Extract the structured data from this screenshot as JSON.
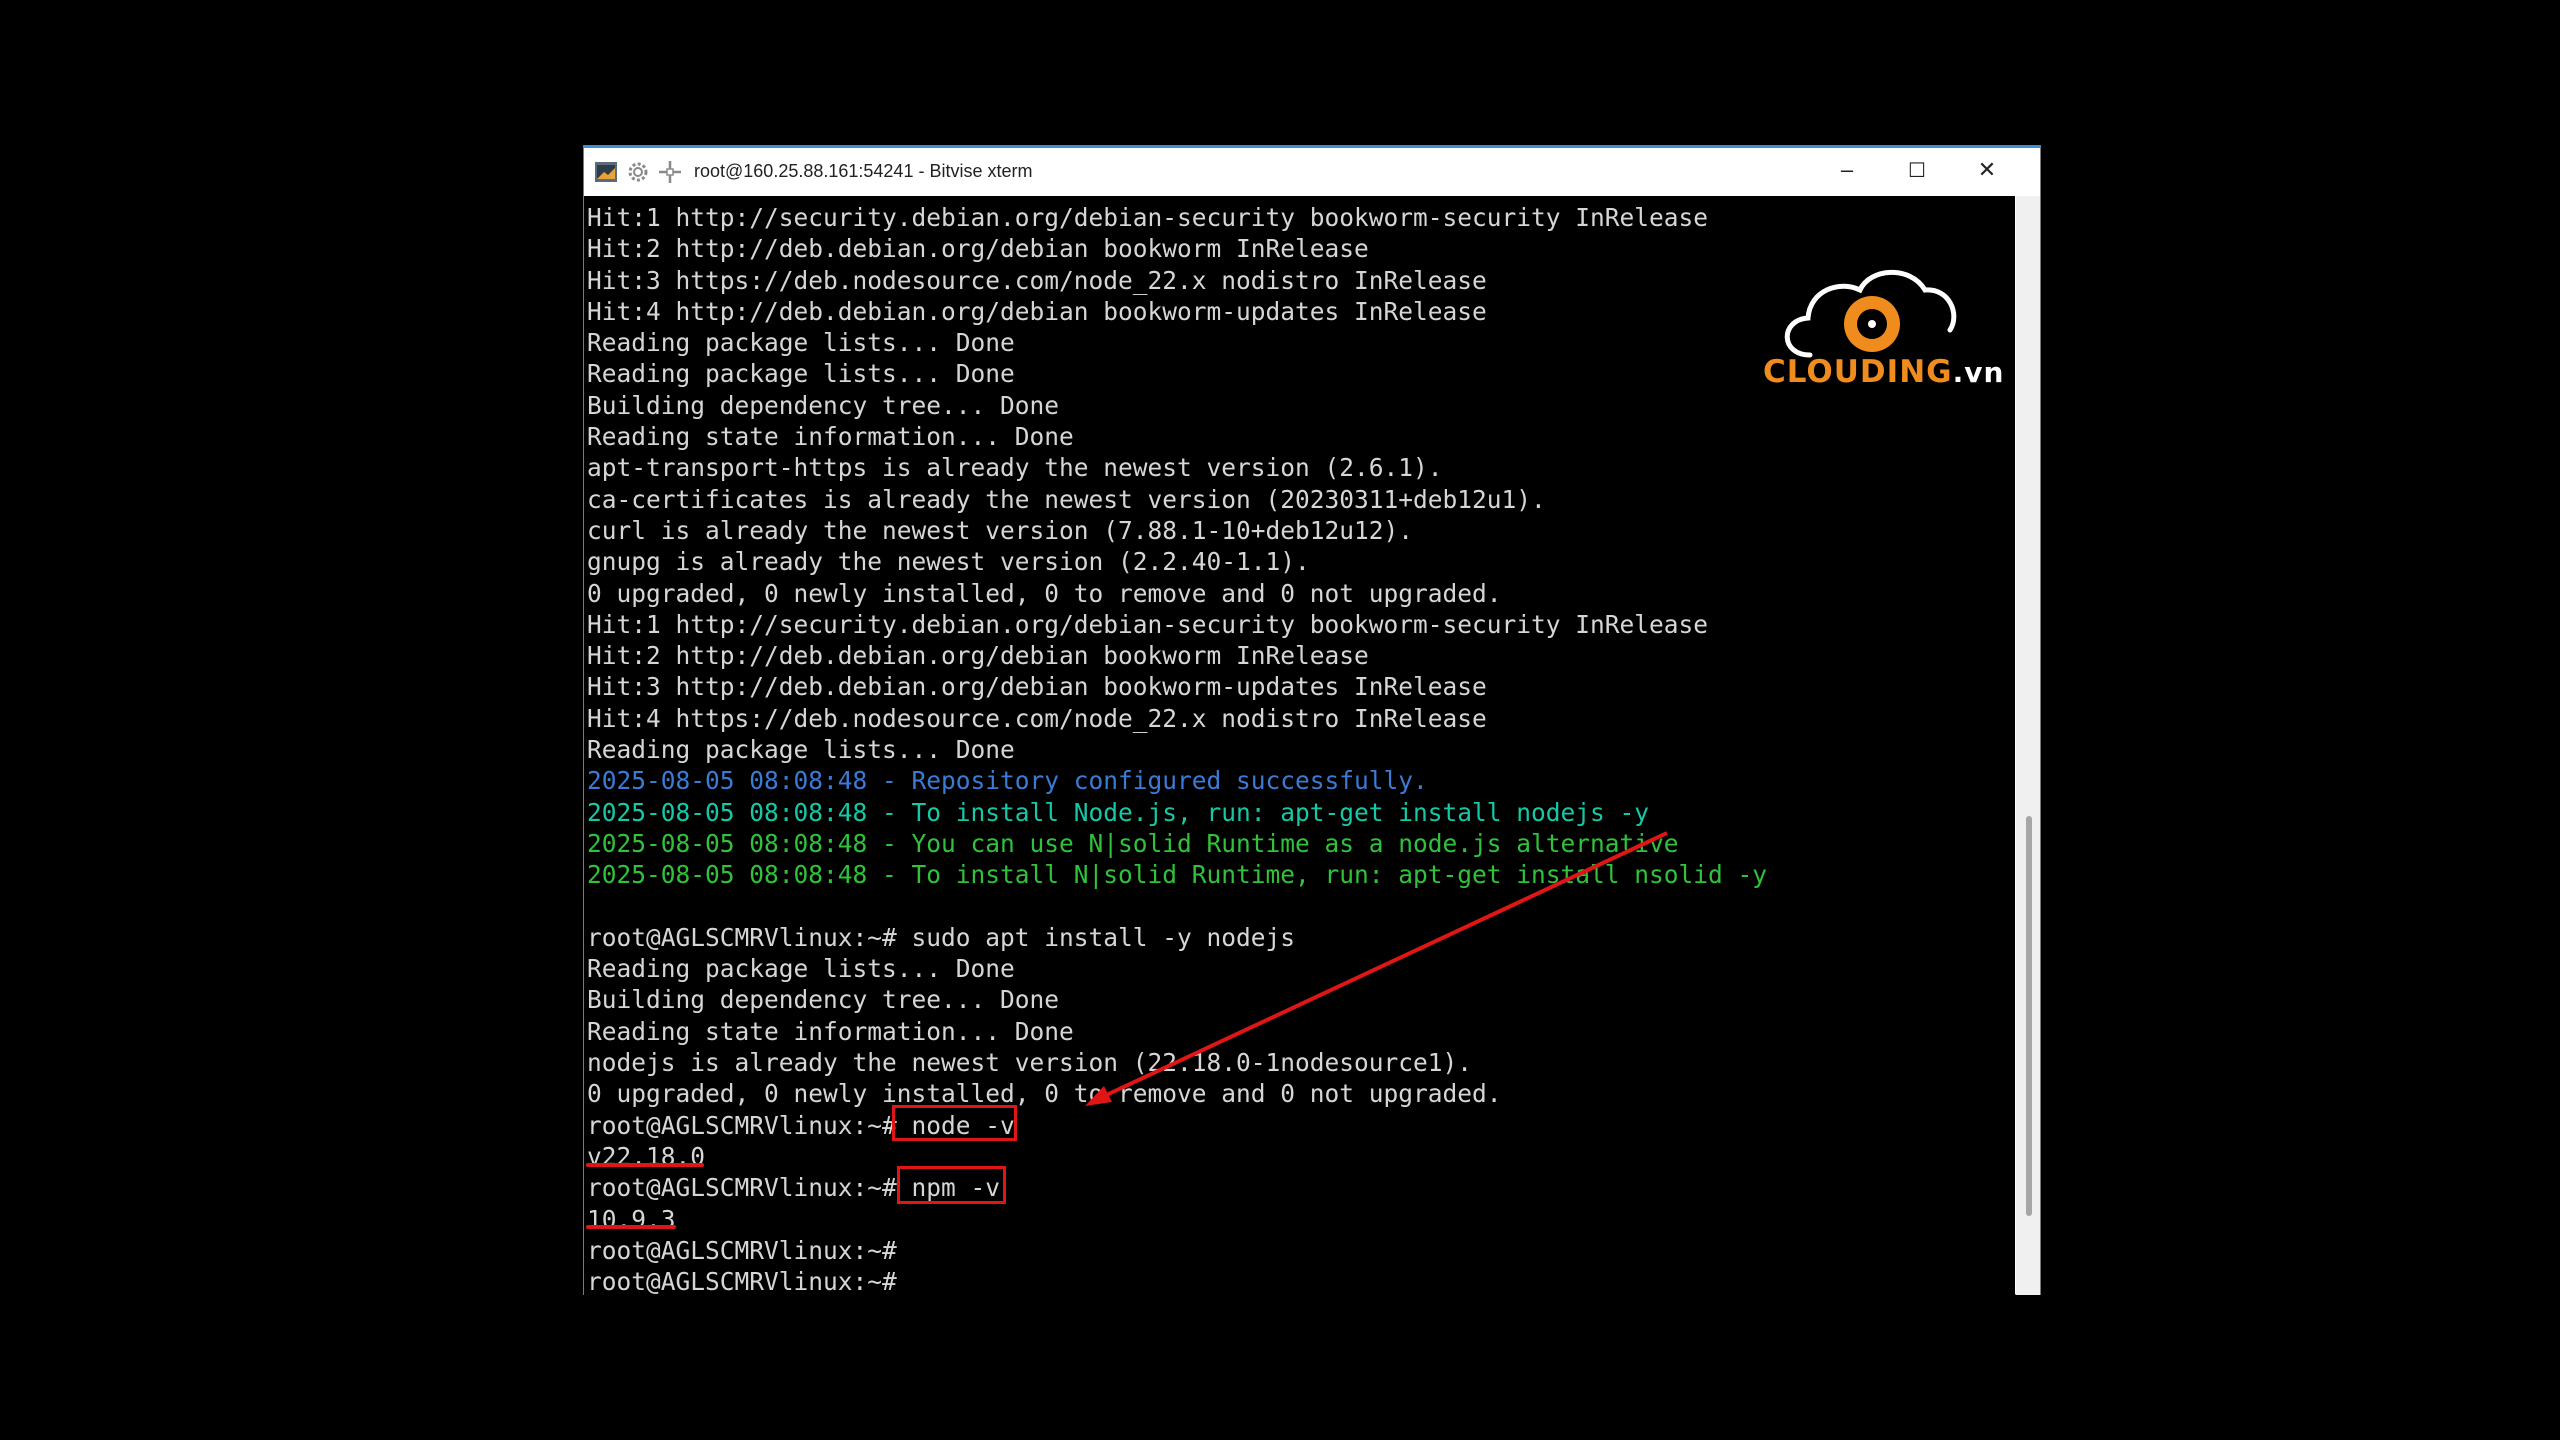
{
  "window": {
    "title": "root@160.25.88.161:54241 - Bitvise xterm",
    "accent_color": "#3b8fd6",
    "icons": [
      "terminal-app-icon",
      "gear-icon",
      "move-icon"
    ],
    "controls": {
      "minimize": "–",
      "maximize": "☐",
      "close": "✕"
    }
  },
  "logo": {
    "brand": "CLOUDING",
    "tld": ".vn",
    "brand_color": "#f08c1e"
  },
  "terminal": {
    "background": "#000000",
    "lines": [
      {
        "text": "Hit:1 http://security.debian.org/debian-security bookworm-security InRelease",
        "color": "default"
      },
      {
        "text": "Hit:2 http://deb.debian.org/debian bookworm InRelease",
        "color": "default"
      },
      {
        "text": "Hit:3 https://deb.nodesource.com/node_22.x nodistro InRelease",
        "color": "default"
      },
      {
        "text": "Hit:4 http://deb.debian.org/debian bookworm-updates InRelease",
        "color": "default"
      },
      {
        "text": "Reading package lists... Done",
        "color": "default"
      },
      {
        "text": "Reading package lists... Done",
        "color": "default"
      },
      {
        "text": "Building dependency tree... Done",
        "color": "default"
      },
      {
        "text": "Reading state information... Done",
        "color": "default"
      },
      {
        "text": "apt-transport-https is already the newest version (2.6.1).",
        "color": "default"
      },
      {
        "text": "ca-certificates is already the newest version (20230311+deb12u1).",
        "color": "default"
      },
      {
        "text": "curl is already the newest version (7.88.1-10+deb12u12).",
        "color": "default"
      },
      {
        "text": "gnupg is already the newest version (2.2.40-1.1).",
        "color": "default"
      },
      {
        "text": "0 upgraded, 0 newly installed, 0 to remove and 0 not upgraded.",
        "color": "default"
      },
      {
        "text": "Hit:1 http://security.debian.org/debian-security bookworm-security InRelease",
        "color": "default"
      },
      {
        "text": "Hit:2 http://deb.debian.org/debian bookworm InRelease",
        "color": "default"
      },
      {
        "text": "Hit:3 http://deb.debian.org/debian bookworm-updates InRelease",
        "color": "default"
      },
      {
        "text": "Hit:4 https://deb.nodesource.com/node_22.x nodistro InRelease",
        "color": "default"
      },
      {
        "text": "Reading package lists... Done",
        "color": "default"
      },
      {
        "text": "2025-08-05 08:08:48 - Repository configured successfully.",
        "color": "blue"
      },
      {
        "text": "2025-08-05 08:08:48 - To install Node.js, run: apt-get install nodejs -y",
        "color": "teal"
      },
      {
        "text": "2025-08-05 08:08:48 - You can use N|solid Runtime as a node.js alternative",
        "color": "green"
      },
      {
        "text": "2025-08-05 08:08:48 - To install N|solid Runtime, run: apt-get install nsolid -y",
        "color": "green"
      },
      {
        "text": "",
        "color": "default"
      },
      {
        "text": "root@AGLSCMRVlinux:~# sudo apt install -y nodejs",
        "color": "default"
      },
      {
        "text": "Reading package lists... Done",
        "color": "default"
      },
      {
        "text": "Building dependency tree... Done",
        "color": "default"
      },
      {
        "text": "Reading state information... Done",
        "color": "default"
      },
      {
        "text": "nodejs is already the newest version (22.18.0-1nodesource1).",
        "color": "default"
      },
      {
        "text": "0 upgraded, 0 newly installed, 0 to remove and 0 not upgraded.",
        "color": "default"
      },
      {
        "text": "root@AGLSCMRVlinux:~# node -v",
        "color": "default"
      },
      {
        "text": "v22.18.0",
        "color": "default"
      },
      {
        "text": "root@AGLSCMRVlinux:~# npm -v",
        "color": "default"
      },
      {
        "text": "10.9.3",
        "color": "default"
      },
      {
        "text": "root@AGLSCMRVlinux:~#",
        "color": "default"
      },
      {
        "text": "root@AGLSCMRVlinux:~#",
        "color": "default"
      }
    ]
  },
  "annotations": {
    "highlight_color": "#e01515",
    "boxed_commands": [
      "node -v",
      "npm -v"
    ],
    "underlined_outputs": [
      "v22.18.0",
      "10.9.3"
    ]
  }
}
